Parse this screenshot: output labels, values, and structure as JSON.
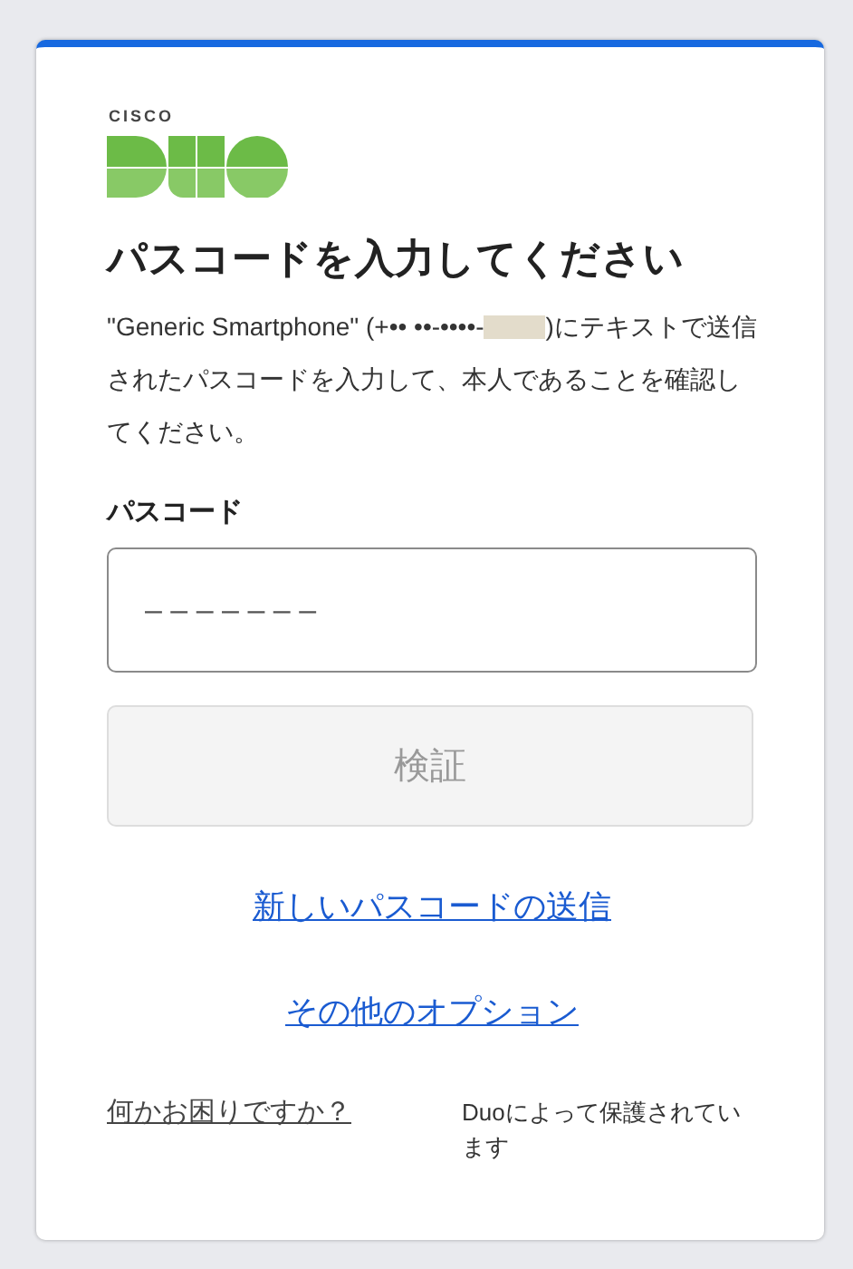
{
  "logo": {
    "brand_text": "CISCO"
  },
  "title": "パスコードを入力してください",
  "description": {
    "before_redaction": "\"Generic Smartphone\" (+•• ••-••••-",
    "after_redaction": ")にテキストで送信されたパスコードを入力して、本人であることを確認してください。"
  },
  "passcode_field": {
    "label": "パスコード",
    "placeholder": "– – – – – – –"
  },
  "verify_button": {
    "label": "検証",
    "disabled": true
  },
  "links": [
    {
      "label": "新しいパスコードの送信"
    },
    {
      "label": "その他のオプション"
    }
  ],
  "footer": {
    "help_link": "何かお困りですか？",
    "protected_by": "Duoによって保護されています"
  }
}
